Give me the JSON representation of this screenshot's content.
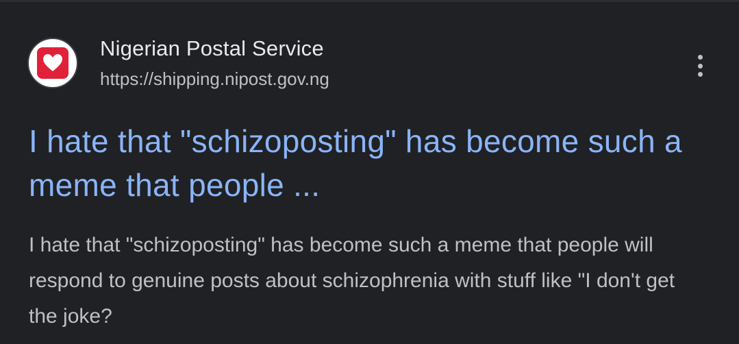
{
  "result": {
    "site_name": "Nigerian Postal Service",
    "site_url": "https://shipping.nipost.gov.ng",
    "favicon_icon": "heart-icon",
    "more_icon": "more-vertical-icon",
    "title": "I hate that \"schizoposting\" has become such a meme that people ...",
    "snippet": "I hate that \"schizoposting\" has become such a meme that people will respond to genuine posts about schizophrenia with stuff like \"I don't get the joke?"
  },
  "colors": {
    "background": "#202124",
    "title_link": "#8ab4f8",
    "favicon_red": "#e0213a"
  }
}
